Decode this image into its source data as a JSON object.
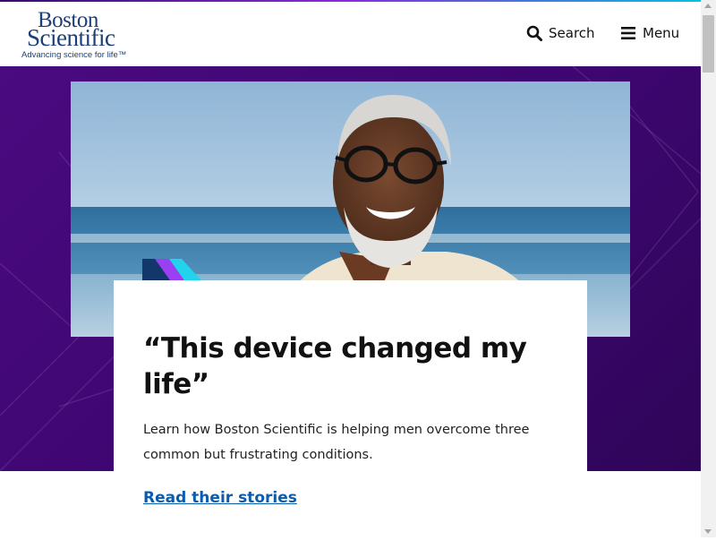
{
  "header": {
    "logo": {
      "line1": "Boston",
      "line2": "Scientific",
      "tagline": "Advancing science for life™"
    },
    "search_label": "Search",
    "menu_label": "Menu"
  },
  "hero": {
    "headline": "“This device changed my life”",
    "description": "Learn how Boston Scientific is helping men overcome three common but frustrating conditions.",
    "cta_label": "Read their stories"
  },
  "colors": {
    "brand_blue": "#1b3f7a",
    "hero_purple": "#3d0670",
    "link_blue": "#0b5cad",
    "chevron_navy": "#14376b",
    "chevron_purple": "#9b3ff2",
    "chevron_cyan": "#22d3ee"
  },
  "icons": [
    "search-icon",
    "menu-icon",
    "chevron-arrows-icon"
  ]
}
